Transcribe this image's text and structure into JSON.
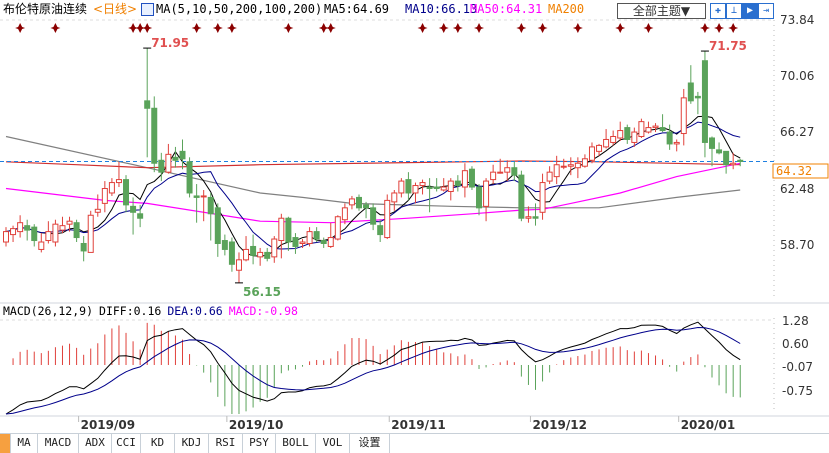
{
  "header": {
    "title": "布伦特原油连续",
    "period": "<日线>",
    "ma_params": "MA(5,10,50,200,100,200)",
    "ma5": "MA5:64.69",
    "ma10": "MA10:66.13",
    "ma50": "MA50:64.31",
    "ma200": "MA200",
    "theme_button": "全部主题▼",
    "tool_icons": [
      "crosshair-icon",
      "range-icon",
      "play-icon",
      "exit-icon"
    ]
  },
  "macd_header": {
    "params": "MACD(26,12,9)",
    "diff": "DIFF:0.16",
    "dea": "DEA:0.66",
    "macd": "MACD:-0.98"
  },
  "tabs": [
    "MA",
    "MACD",
    "ADX",
    "CCI",
    "KD",
    "KDJ",
    "RSI",
    "PSY",
    "BOLL",
    "VOL",
    "设置"
  ],
  "colors": {
    "up": "#e0403a",
    "down": "#5aa35a",
    "ma5": "#000000",
    "ma10": "#00008b",
    "ma50": "#ff00ff",
    "ma100": "#808080",
    "ma200": "#d03030",
    "last_price": "#1e7fe0",
    "marker": "#8b0000"
  },
  "chart_data": {
    "type": "candlestick",
    "title": "布伦特原油连续 日线",
    "price_axis": {
      "ticks": [
        "73.84",
        "70.06",
        "66.27",
        "62.48",
        "58.70"
      ],
      "range": [
        56.15,
        73.84
      ]
    },
    "last_price": "64.32",
    "annotations": {
      "high1": {
        "label": "71.95",
        "index": 20,
        "value": 71.95
      },
      "high2": {
        "label": "71.75",
        "index": 99,
        "value": 71.75
      },
      "low": {
        "label": "56.15",
        "index": 33,
        "value": 56.15
      }
    },
    "time_axis": [
      {
        "label": "2019/09",
        "index": 10
      },
      {
        "label": "2019/10",
        "index": 31
      },
      {
        "label": "2019/11",
        "index": 54
      },
      {
        "label": "2019/12",
        "index": 74
      },
      {
        "label": "2020/01",
        "index": 95
      }
    ],
    "event_marker_indices": [
      2,
      7,
      18,
      19,
      20,
      27,
      30,
      32,
      40,
      45,
      46,
      59,
      62,
      64,
      67,
      73,
      76,
      81,
      87,
      91,
      99,
      101,
      103
    ],
    "ohlc": [
      [
        58.9,
        59.9,
        58.6,
        59.6
      ],
      [
        59.4,
        60.0,
        58.9,
        59.8
      ],
      [
        59.6,
        60.7,
        59.2,
        60.2
      ],
      [
        60.0,
        60.4,
        59.0,
        59.7
      ],
      [
        59.9,
        60.1,
        58.6,
        59.0
      ],
      [
        58.4,
        59.5,
        58.2,
        58.9
      ],
      [
        59.0,
        60.3,
        58.8,
        59.6
      ],
      [
        58.9,
        60.4,
        58.6,
        60.1
      ],
      [
        59.7,
        60.6,
        59.5,
        60.0
      ],
      [
        60.1,
        60.6,
        59.6,
        60.3
      ],
      [
        60.2,
        60.4,
        58.9,
        59.2
      ],
      [
        58.8,
        59.3,
        57.6,
        58.3
      ],
      [
        58.2,
        61.0,
        58.2,
        60.7
      ],
      [
        60.9,
        62.1,
        60.6,
        61.1
      ],
      [
        61.5,
        63.0,
        60.9,
        62.5
      ],
      [
        62.2,
        63.2,
        62.0,
        62.9
      ],
      [
        62.9,
        64.3,
        62.6,
        63.1
      ],
      [
        63.1,
        63.4,
        60.9,
        61.4
      ],
      [
        61.3,
        61.9,
        59.4,
        60.9
      ],
      [
        60.8,
        61.4,
        59.9,
        60.5
      ],
      [
        68.4,
        71.95,
        64.6,
        67.9
      ],
      [
        67.9,
        68.7,
        63.6,
        64.2
      ],
      [
        64.4,
        64.9,
        63.0,
        63.6
      ],
      [
        63.6,
        65.5,
        63.5,
        64.8
      ],
      [
        64.6,
        65.3,
        63.9,
        64.4
      ],
      [
        65.0,
        65.8,
        63.8,
        64.5
      ],
      [
        64.3,
        64.6,
        61.9,
        62.2
      ],
      [
        62.0,
        62.8,
        60.2,
        61.9
      ],
      [
        62.0,
        62.4,
        60.3,
        62.0
      ],
      [
        61.9,
        62.2,
        59.0,
        60.8
      ],
      [
        61.2,
        61.5,
        57.9,
        58.8
      ],
      [
        59.0,
        59.4,
        58.0,
        58.4
      ],
      [
        58.9,
        59.2,
        56.9,
        57.4
      ],
      [
        57.0,
        58.2,
        56.15,
        57.7
      ],
      [
        57.7,
        59.3,
        57.6,
        58.4
      ],
      [
        58.6,
        59.4,
        57.4,
        58.0
      ],
      [
        57.9,
        58.5,
        57.3,
        58.2
      ],
      [
        58.2,
        58.5,
        57.6,
        57.8
      ],
      [
        57.9,
        59.3,
        57.5,
        59.1
      ],
      [
        59.0,
        60.8,
        57.8,
        60.5
      ],
      [
        60.5,
        60.6,
        58.3,
        58.9
      ],
      [
        59.2,
        59.5,
        58.1,
        58.6
      ],
      [
        58.8,
        59.1,
        58.5,
        58.9
      ],
      [
        58.8,
        59.9,
        58.6,
        59.6
      ],
      [
        59.6,
        59.9,
        58.9,
        59.1
      ],
      [
        59.0,
        59.2,
        58.5,
        58.8
      ],
      [
        58.6,
        60.2,
        58.5,
        59.2
      ],
      [
        59.1,
        60.7,
        59.0,
        60.6
      ],
      [
        60.4,
        61.5,
        60.1,
        61.2
      ],
      [
        61.4,
        62.0,
        61.1,
        61.8
      ],
      [
        61.9,
        62.1,
        61.0,
        61.2
      ],
      [
        61.4,
        61.6,
        60.5,
        61.2
      ],
      [
        61.2,
        61.5,
        59.7,
        60.1
      ],
      [
        60.0,
        60.4,
        58.9,
        59.4
      ],
      [
        59.2,
        62.1,
        59.1,
        61.7
      ],
      [
        61.6,
        62.4,
        61.0,
        62.2
      ],
      [
        62.2,
        63.2,
        61.9,
        63.0
      ],
      [
        63.1,
        63.6,
        61.7,
        62.2
      ],
      [
        62.2,
        62.9,
        61.5,
        62.7
      ],
      [
        62.7,
        63.1,
        62.1,
        62.9
      ],
      [
        62.6,
        63.2,
        60.9,
        62.5
      ],
      [
        62.6,
        63.2,
        62.3,
        62.5
      ],
      [
        62.4,
        63.2,
        62.3,
        62.6
      ],
      [
        62.3,
        63.2,
        61.7,
        63.0
      ],
      [
        63.0,
        63.4,
        62.3,
        62.7
      ],
      [
        62.6,
        64.2,
        61.9,
        63.7
      ],
      [
        63.8,
        64.0,
        62.4,
        62.6
      ],
      [
        62.6,
        62.8,
        60.7,
        61.2
      ],
      [
        61.3,
        63.2,
        60.3,
        63.0
      ],
      [
        63.1,
        64.1,
        62.8,
        63.6
      ],
      [
        63.6,
        64.5,
        63.5,
        63.6
      ],
      [
        63.6,
        64.4,
        63.0,
        63.9
      ],
      [
        63.9,
        64.3,
        63.0,
        63.4
      ],
      [
        63.4,
        63.7,
        60.3,
        60.5
      ],
      [
        60.5,
        61.3,
        60.2,
        60.6
      ],
      [
        60.6,
        61.5,
        60.0,
        60.5
      ],
      [
        60.9,
        63.5,
        60.4,
        62.9
      ],
      [
        63.0,
        64.0,
        62.8,
        63.6
      ],
      [
        63.3,
        64.7,
        62.8,
        64.1
      ],
      [
        64.0,
        64.5,
        63.8,
        64.0
      ],
      [
        64.0,
        64.6,
        63.4,
        64.1
      ],
      [
        63.9,
        64.6,
        63.2,
        64.2
      ],
      [
        64.0,
        64.8,
        63.9,
        64.5
      ],
      [
        64.4,
        65.6,
        64.2,
        65.3
      ],
      [
        65.0,
        65.5,
        64.7,
        65.4
      ],
      [
        65.3,
        66.5,
        65.2,
        65.8
      ],
      [
        65.6,
        66.4,
        65.4,
        66.0
      ],
      [
        65.9,
        67.0,
        65.7,
        66.4
      ],
      [
        66.6,
        66.8,
        65.5,
        65.8
      ],
      [
        65.6,
        66.6,
        65.3,
        66.3
      ],
      [
        66.0,
        67.2,
        65.9,
        67.0
      ],
      [
        66.3,
        67.0,
        66.2,
        66.6
      ],
      [
        66.6,
        66.9,
        66.3,
        66.7
      ],
      [
        66.6,
        67.5,
        66.3,
        66.4
      ],
      [
        66.3,
        66.8,
        65.1,
        65.5
      ],
      [
        65.5,
        65.8,
        65.0,
        65.6
      ],
      [
        66.2,
        69.2,
        65.4,
        68.6
      ],
      [
        69.6,
        70.8,
        68.2,
        68.4
      ],
      [
        68.7,
        69.0,
        67.5,
        68.6
      ],
      [
        71.1,
        71.75,
        64.6,
        65.6
      ],
      [
        65.9,
        66.0,
        64.0,
        65.2
      ],
      [
        65.1,
        65.6,
        64.8,
        64.9
      ],
      [
        65.0,
        65.0,
        63.5,
        64.1
      ],
      [
        64.1,
        64.9,
        63.8,
        64.2
      ],
      [
        64.4,
        64.5,
        64.0,
        64.32
      ]
    ],
    "ma_lines": {
      "MA50": [
        [
          0,
          62.5
        ],
        [
          14,
          61.7
        ],
        [
          20,
          61.5
        ],
        [
          36,
          60.3
        ],
        [
          46,
          60.2
        ],
        [
          57,
          60.5
        ],
        [
          66,
          60.8
        ],
        [
          73,
          61.05
        ],
        [
          76,
          61.1
        ],
        [
          80,
          61.5
        ],
        [
          87,
          62.2
        ],
        [
          95,
          63.3
        ],
        [
          104,
          64.2
        ]
      ],
      "MA100": [
        [
          0,
          66.0
        ],
        [
          20,
          63.9
        ],
        [
          36,
          62.2
        ],
        [
          42,
          61.9
        ],
        [
          49,
          61.5
        ],
        [
          63,
          61.3
        ],
        [
          73,
          61.2
        ],
        [
          84,
          61.2
        ],
        [
          95,
          61.9
        ],
        [
          104,
          62.4
        ]
      ],
      "MA200": [
        [
          0,
          64.3
        ],
        [
          10,
          64.1
        ],
        [
          20,
          63.9
        ],
        [
          36,
          64.1
        ],
        [
          73,
          64.35
        ],
        [
          84,
          64.3
        ],
        [
          104,
          64.1
        ]
      ]
    },
    "macd": {
      "short": 12,
      "long": 26,
      "signal": 9,
      "initial_diff": -1.42,
      "initial_dea": -1.42,
      "ticks": [
        "1.28",
        "0.60",
        "-0.07",
        "-0.75"
      ]
    }
  }
}
